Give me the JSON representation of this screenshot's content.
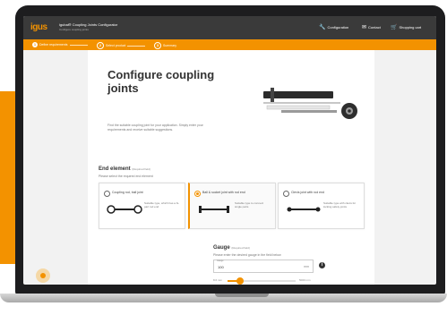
{
  "app": {
    "logo": "igus",
    "title": "igubal® Coupling Joints Configurator",
    "subtitle": "Configure coupling joints"
  },
  "nav": [
    {
      "label": "Configuration",
      "icon": "wrench-icon"
    },
    {
      "label": "Contact",
      "icon": "mail-icon"
    },
    {
      "label": "Shopping cart",
      "icon": "cart-icon"
    }
  ],
  "steps": [
    {
      "num": "1",
      "label": "Define requirements"
    },
    {
      "num": "2",
      "label": "Select product"
    },
    {
      "num": "3",
      "label": "Summary"
    }
  ],
  "page": {
    "title": "Configure coupling joints",
    "intro": "Find the suitable coupling joint for your application. Simply enter your requirements and receive suitable suggestions."
  },
  "end_element": {
    "title": "End element",
    "title_note": "(Required field)",
    "subtitle": "Please select the required end element",
    "options": [
      {
        "label": "Coupling rod, ball joint",
        "desc": "Suitable type, which has a bi-part rod end",
        "selected": false
      },
      {
        "label": "Ball & socket joint with rod end",
        "desc": "Suitable type to connect single parts",
        "selected": true
      },
      {
        "label": "Clevis joint with rod end",
        "desc": "Suitable type with clevis for locking safety joints",
        "selected": false
      }
    ]
  },
  "gauge": {
    "title": "Gauge",
    "title_note": "(Required field)",
    "subtitle": "Please enter the desired gauge in the field below",
    "field_label": "Gauge",
    "value": "100",
    "unit": "mm",
    "info_icon": "i",
    "min_label": "8.6 mm",
    "max_label": "5000 mm",
    "slider_fraction": 0.18
  },
  "colors": {
    "accent": "#f39200",
    "dark": "#3a3a3a"
  }
}
